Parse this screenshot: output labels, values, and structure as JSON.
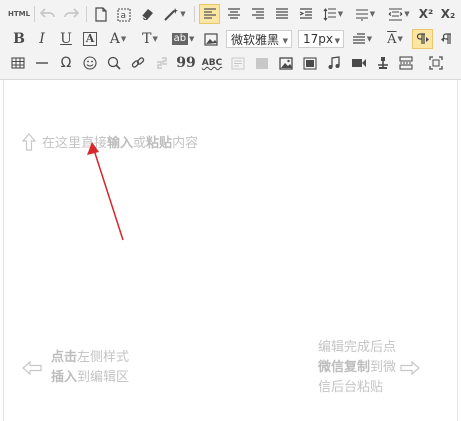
{
  "toolbar": {
    "html_label": "HTML",
    "font_family": "微软雅黑",
    "font_size": "17px",
    "abc_label": "ABC",
    "text_t": "T",
    "text_a": "A",
    "bold_label": "B",
    "italic_label": "I",
    "underline_label": "U",
    "superscript_label": "X²",
    "subscript_label": "X₂",
    "quote_label": "99",
    "omega_label": "Ω",
    "ab_label": "ab"
  },
  "editor": {
    "upload_hint_prefix": "在这里直接",
    "upload_hint_bold1": "输入",
    "upload_hint_middle": "或",
    "upload_hint_bold2": "粘贴",
    "upload_hint_suffix": "内容",
    "left_hint_line1_bold": "点击",
    "left_hint_line1_rest": "左侧样式",
    "left_hint_line2_bold": "插入",
    "left_hint_line2_rest": "到编辑区",
    "right_hint_line1": "编辑完成后点",
    "right_hint_line2_bold": "微信复制",
    "right_hint_line2_rest": "到微",
    "right_hint_line3": "信后台粘贴"
  },
  "colors": {
    "toolbar_bg": "#f3f3f3",
    "active_bg": "#fbe6a3",
    "hint_text": "#c4c4c4",
    "arrow": "#d9262b"
  }
}
